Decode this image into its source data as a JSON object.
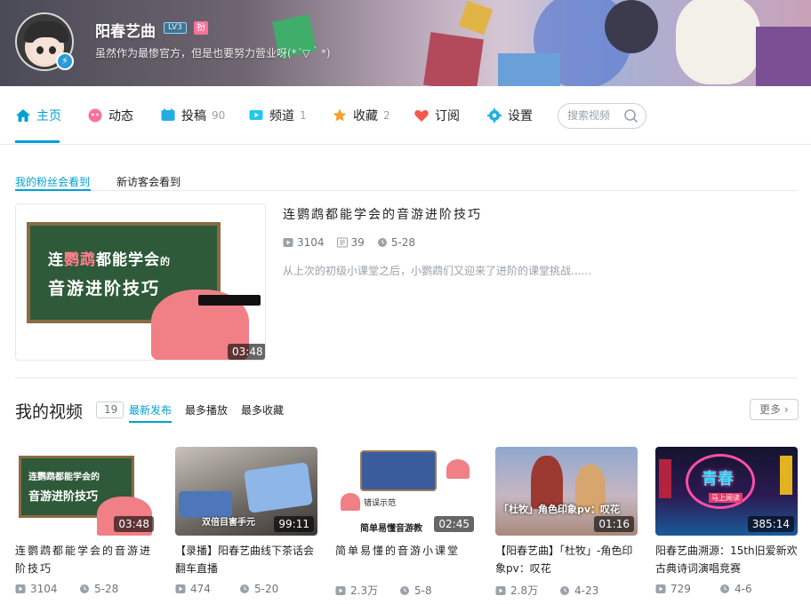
{
  "profile": {
    "name": "阳春艺曲",
    "level": "LV3",
    "fans_badge": "扮",
    "sign": "虽然作为最惨官方，但是也要努力营业呀(*´▽｀*)"
  },
  "nav": {
    "home": "主页",
    "dynamic": "动态",
    "submit": "投稿",
    "submit_count": "90",
    "channel": "频道",
    "channel_count": "1",
    "favorite": "收藏",
    "favorite_count": "2",
    "subscribe": "订阅",
    "settings": "设置",
    "search_placeholder": "搜索视频"
  },
  "featured": {
    "tab_fans": "我的粉丝会看到",
    "tab_visitor": "新访客会看到",
    "board_line1_a": "连",
    "board_line1_b": "鹦鹉",
    "board_line1_c": "都能学会",
    "board_line1_d": "的",
    "board_line2": "音游进阶技巧",
    "duration": "03:48",
    "title": "连鹦鹉都能学会的音游进阶技巧",
    "plays": "3104",
    "danmaku": "39",
    "date": "5-28",
    "desc": "从上次的初级小课堂之后，小鹦鹉们又迎来了进阶的课堂挑战......"
  },
  "videos_section": {
    "title": "我的视频",
    "count": "19",
    "tab_latest": "最新发布",
    "tab_most_played": "最多播放",
    "tab_most_fav": "最多收藏",
    "more": "更多"
  },
  "videos": [
    {
      "title": "连鹦鹉都能学会的音游进阶技巧",
      "duration": "03:48",
      "plays": "3104",
      "date": "5-28",
      "thumb_l1": "连鹦鹉都能学会的",
      "thumb_l2": "音游进阶技巧"
    },
    {
      "title": "【录播】阳春艺曲线下茶话会翻车直播",
      "duration": "99:11",
      "plays": "474",
      "date": "5-20",
      "thumb_l1": "双倍目害手元"
    },
    {
      "title": "简单易懂的音游小课堂",
      "duration": "02:45",
      "plays": "2.3万",
      "date": "5-8",
      "thumb_l1": "错误示范",
      "thumb_l2": "简单易懂音游教"
    },
    {
      "title": "【阳春艺曲】「杜牧」-角色印象pv：叹花",
      "duration": "01:16",
      "plays": "2.8万",
      "date": "4-23",
      "thumb_l1": "「杜牧」角色印象pv：叹花"
    },
    {
      "title": "阳春艺曲溯源：15th旧爱新欢古典诗词演唱竞赛",
      "duration": "385:14",
      "plays": "729",
      "date": "4-6",
      "thumb_l1": "青春",
      "thumb_l2": "马上阅读"
    }
  ]
}
